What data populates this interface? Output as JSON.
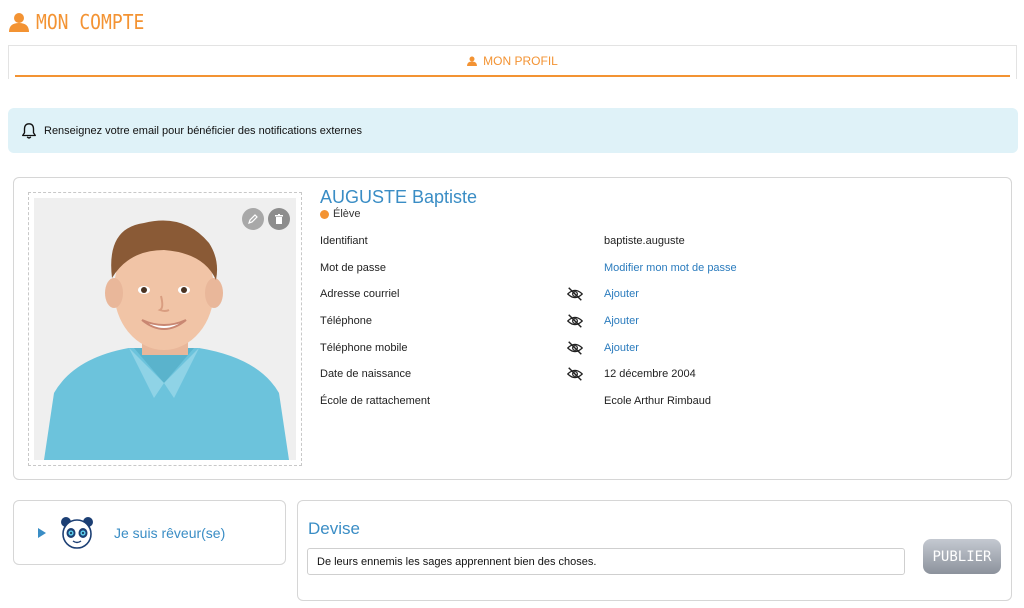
{
  "header": {
    "title": "MON COMPTE",
    "icon": "user-icon"
  },
  "tabs": [
    {
      "label": "MON PROFIL",
      "icon": "user-icon",
      "active": true
    }
  ],
  "notification": {
    "text": "Renseignez votre email pour bénéficier des notifications externes",
    "icon": "bell-icon"
  },
  "profile": {
    "name": "AUGUSTE Baptiste",
    "role": "Élève",
    "fields": [
      {
        "label": "Identifiant",
        "value": "baptiste.auguste",
        "link": false,
        "hidden_icon": false
      },
      {
        "label": "Mot de passe",
        "value": "Modifier mon mot de passe",
        "link": true,
        "hidden_icon": false
      },
      {
        "label": "Adresse courriel",
        "value": "Ajouter",
        "link": true,
        "hidden_icon": true
      },
      {
        "label": "Téléphone",
        "value": "Ajouter",
        "link": true,
        "hidden_icon": true
      },
      {
        "label": "Téléphone mobile",
        "value": "Ajouter",
        "link": true,
        "hidden_icon": true
      },
      {
        "label": "Date de naissance",
        "value": "12 décembre 2004",
        "link": false,
        "hidden_icon": true
      },
      {
        "label": "École de rattachement",
        "value": "Ecole Arthur Rimbaud",
        "link": false,
        "hidden_icon": false
      }
    ]
  },
  "mood": {
    "label": "Je suis rêveur(se)",
    "icon": "panda-icon"
  },
  "devise": {
    "title": "Devise",
    "value": "De leurs ennemis les sages apprennent bien des choses.",
    "publish_label": "PUBLIER"
  },
  "colors": {
    "accent": "#f39333",
    "link": "#3a8dc5",
    "banner": "#dff2f8"
  }
}
